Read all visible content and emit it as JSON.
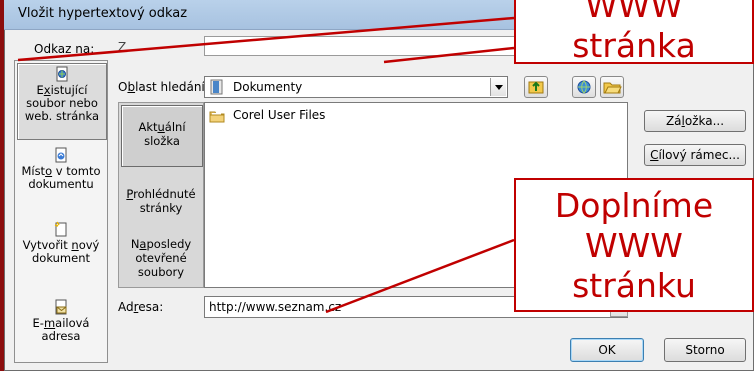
{
  "window": {
    "title": "Vložit hypertextový odkaz"
  },
  "link_to": {
    "label": "Odkaz na:",
    "hidden_label_fragment": "Z"
  },
  "places": [
    {
      "label_pre": "E",
      "label_u": "x",
      "label_post": "istující",
      "line2": "soubor nebo",
      "line3": "web. stránka",
      "icon": "existing-file-icon"
    },
    {
      "label_pre": "Míst",
      "label_u": "o",
      "label_post": " v tomto",
      "line2": "dokumentu",
      "icon": "place-in-document-icon"
    },
    {
      "label_pre": "Vytvořit ",
      "label_u": "n",
      "label_post": "ový",
      "line2": "dokument",
      "icon": "new-document-icon"
    },
    {
      "label_pre": "E-",
      "label_u": "m",
      "label_post": "ailová",
      "line2": "adresa",
      "icon": "email-icon"
    }
  ],
  "look_in": {
    "label_pre": "O",
    "label_u": "b",
    "label_post": "last hledání:",
    "value": "Dokumenty"
  },
  "nav": [
    {
      "l1_pre": "Akt",
      "l1_u": "u",
      "l1_post": "ální",
      "l2": "složka"
    },
    {
      "l1_pre": "",
      "l1_u": "P",
      "l1_post": "rohlédnuté",
      "l2": "stránky"
    },
    {
      "l1_pre": "N",
      "l1_u": "a",
      "l1_post": "posledy",
      "l2": "otevřené",
      "l3": "soubory"
    }
  ],
  "files": [
    {
      "name": "Corel User Files",
      "icon": "folder-icon"
    }
  ],
  "buttons": {
    "bookmark": {
      "pre": "Zá",
      "u": "l",
      "post": "ožka..."
    },
    "target_frame": {
      "pre": "",
      "u": "C",
      "post": "ílový rámec..."
    },
    "ok": "OK",
    "cancel": "Storno"
  },
  "address": {
    "label_pre": "Ad",
    "label_u": "r",
    "label_post": "esa:",
    "value": "http://www.seznam.cz"
  },
  "callouts": {
    "top": {
      "line1": "WWW",
      "line2": "stránka"
    },
    "bottom": {
      "line1": "Doplníme",
      "line2": "WWW",
      "line3": "stránku"
    }
  },
  "colors": {
    "accent": "#c00000",
    "background": "#8b0d0d"
  }
}
